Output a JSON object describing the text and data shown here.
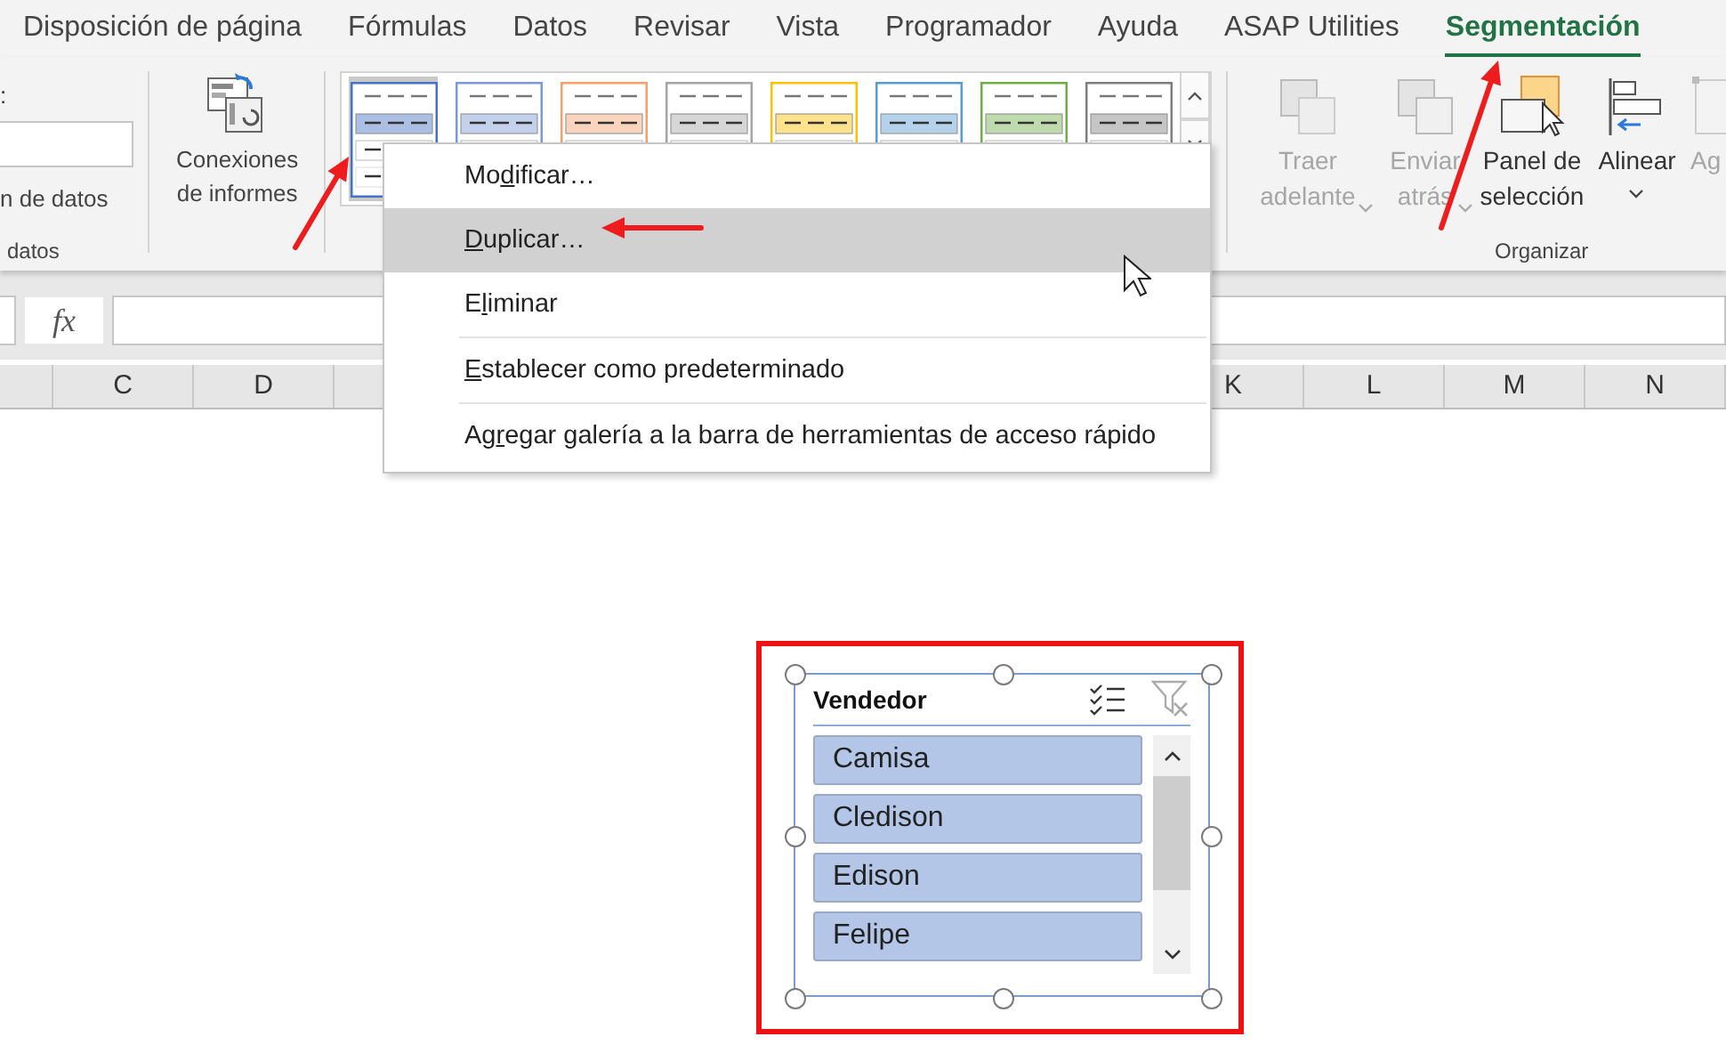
{
  "ribbon_tabs": [
    {
      "label": "Disposición de página",
      "selected": false
    },
    {
      "label": "Fórmulas",
      "selected": false
    },
    {
      "label": "Datos",
      "selected": false
    },
    {
      "label": "Revisar",
      "selected": false
    },
    {
      "label": "Vista",
      "selected": false
    },
    {
      "label": "Programador",
      "selected": false
    },
    {
      "label": "Ayuda",
      "selected": false
    },
    {
      "label": "ASAP Utilities",
      "selected": false
    },
    {
      "label": "Segmentación",
      "selected": true
    }
  ],
  "ribbon": {
    "partial_group": {
      "field_label": ":",
      "button_label": "n de datos",
      "group_label": "datos"
    },
    "report_connections": {
      "label": "Conexiones de informes"
    },
    "styles_gallery": [
      {
        "color": "#4472c4",
        "selected": true
      },
      {
        "color": "#7a9ad6",
        "selected": false
      },
      {
        "color": "#f4a06a",
        "selected": false
      },
      {
        "color": "#a5a5a5",
        "selected": false
      },
      {
        "color": "#ffc000",
        "selected": false
      },
      {
        "color": "#5b9bd5",
        "selected": false
      },
      {
        "color": "#70ad47",
        "selected": false
      },
      {
        "color": "#7f7f7f",
        "selected": false
      }
    ],
    "arrange_group": {
      "label": "Organizar",
      "buttons": [
        {
          "kind": "bring-forward",
          "label": "Traer adelante",
          "disabled": true,
          "dropdown": true
        },
        {
          "kind": "send-backward",
          "label": "Enviar atrás",
          "disabled": true,
          "dropdown": true
        },
        {
          "kind": "selection-pane",
          "label": "Panel de selección",
          "disabled": false,
          "dropdown": false
        },
        {
          "kind": "align",
          "label": "Alinear",
          "disabled": false,
          "dropdown": true
        },
        {
          "kind": "group",
          "label": "Ag",
          "disabled": true,
          "dropdown": false
        }
      ]
    }
  },
  "formula_bar": {
    "function_symbol": "fx"
  },
  "columns_left": [
    "C",
    "D"
  ],
  "columns_right": [
    "K",
    "L",
    "M",
    "N"
  ],
  "context_menu": {
    "items": [
      {
        "before": "Mo",
        "key": "d",
        "after": "ificar…",
        "highlighted": false,
        "separator_before": false
      },
      {
        "key": "D",
        "after": "uplicar…",
        "highlighted": true,
        "separator_before": false
      },
      {
        "before": "E",
        "key": "l",
        "after": "iminar",
        "highlighted": false,
        "separator_before": false
      },
      {
        "key": "E",
        "after": "stablecer como predeterminado",
        "highlighted": false,
        "separator_before": true
      },
      {
        "before": "Ag",
        "key": "r",
        "after": "egar galería a la barra de herramientas de acceso rápido",
        "highlighted": false,
        "separator_before": true
      }
    ]
  },
  "slicer": {
    "title": "Vendedor",
    "items": [
      {
        "label": "Camisa",
        "selected": true
      },
      {
        "label": "Cledison",
        "selected": true
      },
      {
        "label": "Edison",
        "selected": true
      },
      {
        "label": "Felipe",
        "selected": true
      }
    ]
  }
}
